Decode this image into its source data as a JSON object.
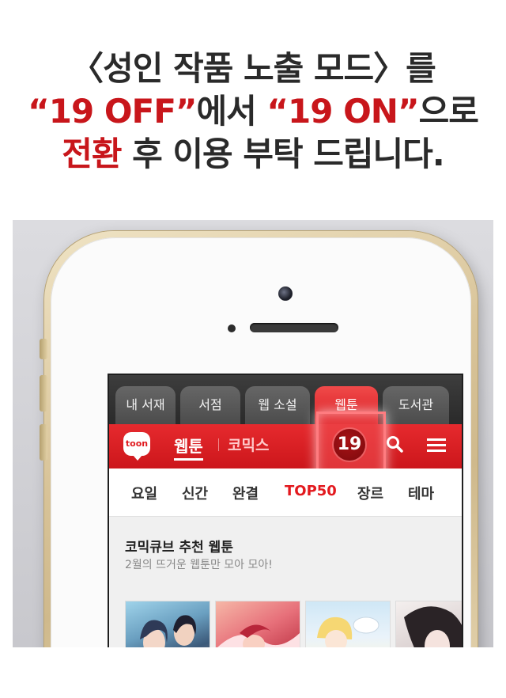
{
  "headline": {
    "line1": "〈성인 작품 노출 모드〉를",
    "line2_red_a": "“19 OFF”",
    "line2_mid": "에서 ",
    "line2_red_b": "“19 ON”",
    "line2_end": "으로",
    "line3_red": "전환",
    "line3_rest": " 후 이용 부탁 드립니다."
  },
  "app": {
    "tabs": [
      {
        "label": "내 서재"
      },
      {
        "label": "서점"
      },
      {
        "label": "웹 소설"
      },
      {
        "label": "웹툰"
      },
      {
        "label": "도서관"
      }
    ],
    "active_tab": "웹툰",
    "logo_text": "toon",
    "nav_primary": "웹툰",
    "nav_secondary": "코믹스",
    "adult_badge": "19",
    "subnav": [
      "요일",
      "신간",
      "완결",
      "TOP50",
      "장르",
      "테마"
    ],
    "subnav_active": "TOP50",
    "section_title": "코믹큐브 추천 웹툰",
    "section_subtitle": "2월의 뜨거운 웹툰만 모아 모아!"
  },
  "colors": {
    "accent_red": "#e0191e",
    "headline_red": "#c8161b"
  }
}
